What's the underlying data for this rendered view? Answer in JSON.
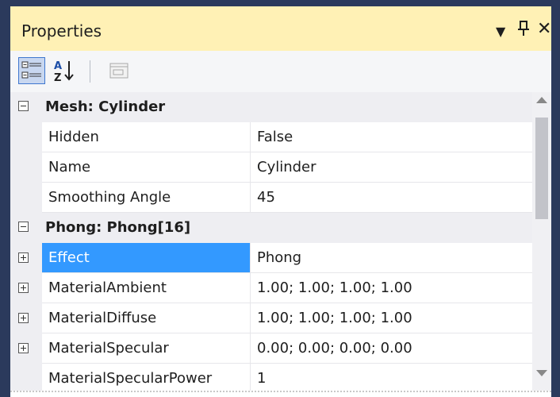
{
  "panel": {
    "title": "Properties",
    "icons": [
      "dropdown-icon",
      "pin-icon",
      "close-icon"
    ],
    "dropdown_glyph": "▼",
    "pin_glyph": "⊥",
    "close_glyph": "✕"
  },
  "toolbar": {
    "buttons": [
      "categorized-icon",
      "alphabetical-sort-icon",
      "property-pages-icon"
    ],
    "alpha_top": "A",
    "alpha_bottom": "Z"
  },
  "categories": [
    {
      "label": "Mesh: Cylinder",
      "rows": [
        {
          "name": "Hidden",
          "value": "False"
        },
        {
          "name": "Name",
          "value": "Cylinder"
        },
        {
          "name": "Smoothing Angle",
          "value": "45"
        }
      ]
    },
    {
      "label": "Phong: Phong[16]",
      "rows": [
        {
          "name": "Effect",
          "value": "Phong",
          "selected": true
        },
        {
          "name": "MaterialAmbient",
          "value": "1.00; 1.00; 1.00; 1.00"
        },
        {
          "name": "MaterialDiffuse",
          "value": "1.00; 1.00; 1.00; 1.00"
        },
        {
          "name": "MaterialSpecular",
          "value": "0.00; 0.00; 0.00; 0.00"
        },
        {
          "name": "MaterialSpecularPower",
          "value": "1"
        }
      ]
    }
  ],
  "colors": {
    "titlebar": "#fff1b5",
    "selection": "#3399ff",
    "frame": "#2b3a5c"
  }
}
